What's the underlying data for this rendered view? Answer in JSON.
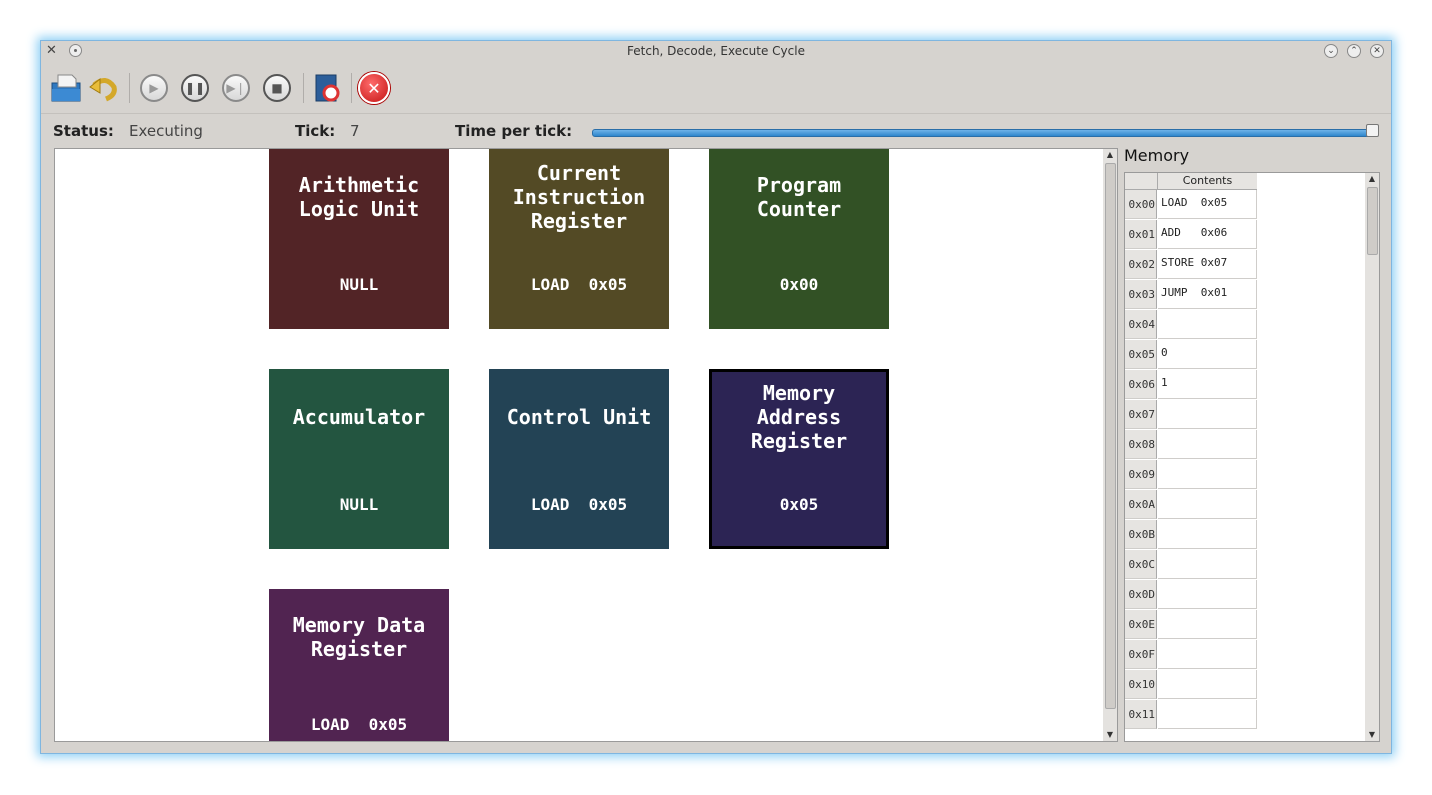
{
  "window": {
    "title": "Fetch, Decode, Execute Cycle"
  },
  "status": {
    "status_label": "Status:",
    "status_value": "Executing",
    "tick_label": "Tick:",
    "tick_value": "7",
    "time_label": "Time per tick:",
    "time_per_tick_fraction": 1.0
  },
  "toolbar": [
    {
      "icon": "open-file-icon"
    },
    {
      "icon": "undo-icon"
    },
    {
      "icon": "play-icon"
    },
    {
      "icon": "pause-icon"
    },
    {
      "icon": "step-icon"
    },
    {
      "icon": "stop-icon"
    },
    {
      "icon": "help-icon"
    },
    {
      "icon": "exit-icon"
    }
  ],
  "components": [
    {
      "name": "Arithmetic\nLogic Unit",
      "value": "NULL",
      "color": "#522426"
    },
    {
      "name": "Current\nInstruction\nRegister",
      "value": "LOAD  0x05",
      "color": "#534a25"
    },
    {
      "name": "Program\nCounter",
      "value": "0x00",
      "color": "#325125"
    },
    {
      "name": "Accumulator",
      "value": "NULL",
      "color": "#235540"
    },
    {
      "name": "Control Unit",
      "value": "LOAD  0x05",
      "color": "#234355"
    },
    {
      "name": "Memory\nAddress\nRegister",
      "value": "0x05",
      "color": "#2c2454",
      "active": true
    },
    {
      "name": "Memory Data\nRegister",
      "value": "LOAD  0x05",
      "color": "#512451"
    }
  ],
  "memory": {
    "title": "Memory",
    "column": "Contents",
    "rows": [
      {
        "addr": "0x00",
        "content": "LOAD  0x05"
      },
      {
        "addr": "0x01",
        "content": "ADD   0x06"
      },
      {
        "addr": "0x02",
        "content": "STORE 0x07"
      },
      {
        "addr": "0x03",
        "content": "JUMP  0x01"
      },
      {
        "addr": "0x04",
        "content": ""
      },
      {
        "addr": "0x05",
        "content": "0"
      },
      {
        "addr": "0x06",
        "content": "1"
      },
      {
        "addr": "0x07",
        "content": ""
      },
      {
        "addr": "0x08",
        "content": ""
      },
      {
        "addr": "0x09",
        "content": ""
      },
      {
        "addr": "0x0A",
        "content": ""
      },
      {
        "addr": "0x0B",
        "content": ""
      },
      {
        "addr": "0x0C",
        "content": ""
      },
      {
        "addr": "0x0D",
        "content": ""
      },
      {
        "addr": "0x0E",
        "content": ""
      },
      {
        "addr": "0x0F",
        "content": ""
      },
      {
        "addr": "0x10",
        "content": ""
      },
      {
        "addr": "0x11",
        "content": ""
      }
    ]
  }
}
